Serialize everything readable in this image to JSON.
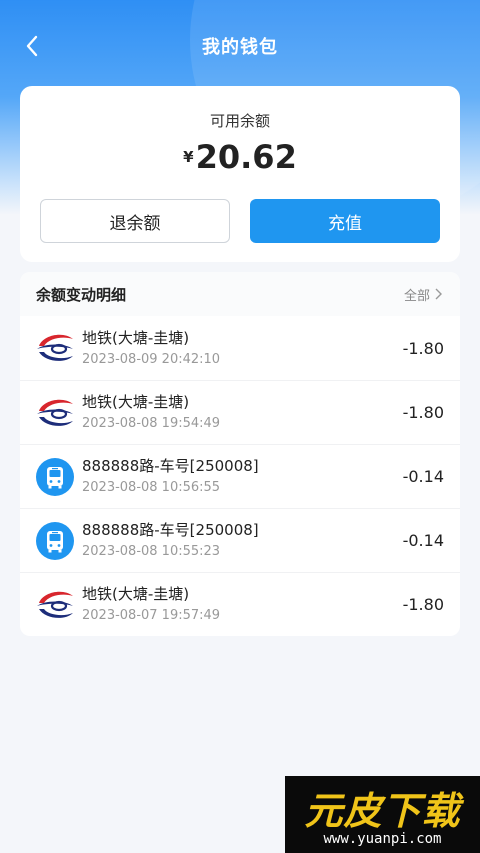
{
  "header": {
    "title": "我的钱包"
  },
  "balance": {
    "label": "可用余额",
    "currency": "¥",
    "amount": "20.62",
    "refund_label": "退余额",
    "recharge_label": "充值"
  },
  "details": {
    "title": "余额变动明细",
    "filter_label": "全部",
    "items": [
      {
        "icon": "metro-logo-icon",
        "title": "地铁(大塘-圭塘)",
        "time": "2023-08-09 20:42:10",
        "amount": "-1.80"
      },
      {
        "icon": "metro-logo-icon",
        "title": "地铁(大塘-圭塘)",
        "time": "2023-08-08 19:54:49",
        "amount": "-1.80"
      },
      {
        "icon": "bus-icon",
        "title": "888888路-车号[250008]",
        "time": "2023-08-08 10:56:55",
        "amount": "-0.14"
      },
      {
        "icon": "bus-icon",
        "title": "888888路-车号[250008]",
        "time": "2023-08-08 10:55:23",
        "amount": "-0.14"
      },
      {
        "icon": "metro-logo-icon",
        "title": "地铁(大塘-圭塘)",
        "time": "2023-08-07 19:57:49",
        "amount": "-1.80"
      }
    ]
  },
  "watermark": {
    "text": "元皮下载",
    "url": "www.yuanpi.com"
  },
  "colors": {
    "accent": "#1f96f0",
    "metro_red": "#d8262d",
    "metro_blue": "#1d2d7a"
  }
}
